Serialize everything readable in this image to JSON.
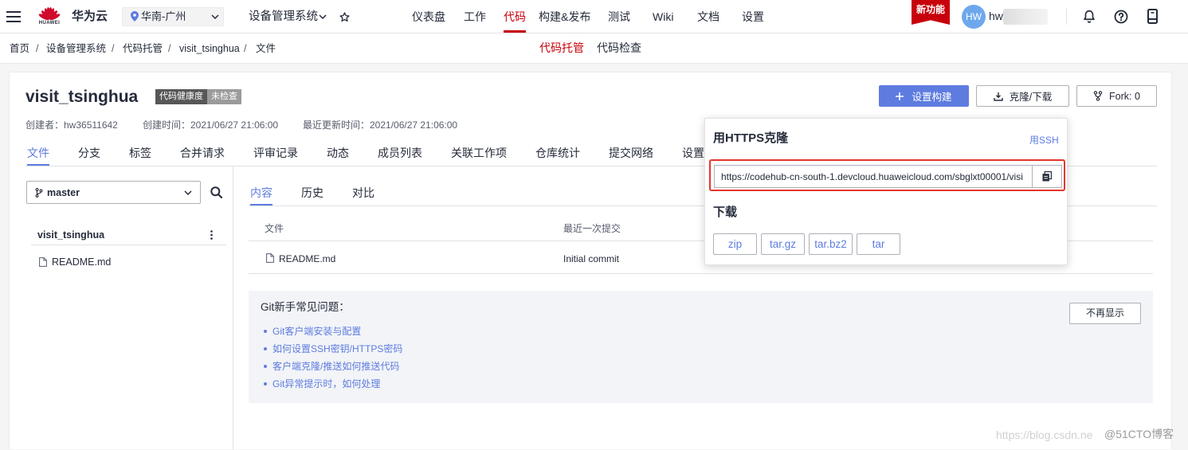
{
  "topnav": {
    "logo_text": "HUAWEI",
    "brand": "华为云",
    "region": "华南-广州",
    "project": "设备管理系统",
    "menu": [
      "仪表盘",
      "工作",
      "代码",
      "构建&发布",
      "测试",
      "Wiki",
      "文档",
      "设置"
    ],
    "active_index": 2,
    "new_feature_badge": "新功能",
    "avatar_initials": "HW",
    "username_visible": "hw"
  },
  "breadcrumb": {
    "items": [
      "首页",
      "设备管理系统",
      "代码托管",
      "visit_tsinghua",
      "文件"
    ],
    "separator": "/"
  },
  "service_tabs": {
    "items": [
      "代码托管",
      "代码检查"
    ],
    "active_index": 0
  },
  "repo": {
    "name": "visit_tsinghua",
    "health_label": "代码健康度",
    "health_status": "未检查",
    "creator": "创建者：hw36511642",
    "created_time": "创建时间：2021/06/27 21:06:00",
    "updated_time": "最近更新时间：2021/06/27 21:06:00"
  },
  "actions": {
    "setup_build": "设置构建",
    "clone_download": "克隆/下载",
    "fork": "Fork: 0"
  },
  "repo_tabs": {
    "items": [
      "文件",
      "分支",
      "标签",
      "合并请求",
      "评审记录",
      "动态",
      "成员列表",
      "关联工作项",
      "仓库统计",
      "提交网络",
      "设置"
    ],
    "active_index": 0
  },
  "file_tree": {
    "branch": "master",
    "root": "visit_tsinghua",
    "files": [
      "README.md"
    ]
  },
  "content_tabs": {
    "items": [
      "内容",
      "历史",
      "对比"
    ],
    "active_index": 0
  },
  "file_table": {
    "columns": [
      "文件",
      "最近一次提交"
    ],
    "rows": [
      {
        "name": "README.md",
        "last_commit": "Initial commit"
      }
    ]
  },
  "git_help": {
    "title": "Git新手常见问题：",
    "links": [
      "Git客户端安装与配置",
      "如何设置SSH密钥/HTTPS密码",
      "客户端克隆/推送如何推送代码",
      "Git异常提示时，如何处理"
    ],
    "dismiss": "不再显示"
  },
  "clone_popover": {
    "title": "用HTTPS克隆",
    "switch_link": "用SSH",
    "url": "https://codehub-cn-south-1.devcloud.huaweicloud.com/sbglxt00001/visi",
    "download_title": "下载",
    "formats": [
      "zip",
      "tar.gz",
      "tar.bz2",
      "tar"
    ]
  },
  "watermark": {
    "url_text": "https://blog.csdn.ne",
    "source": "@51CTO博客"
  },
  "colors": {
    "brand_red": "#c7000b",
    "accent_blue": "#5e7ce0",
    "highlight_red": "#e5352b",
    "avatar_blue": "#6ea8ec",
    "help_bg": "#f2f4f7"
  },
  "icons": [
    "menu-icon",
    "huawei-logo",
    "location-pin-icon",
    "chevron-down-icon",
    "star-icon",
    "bell-icon",
    "help-icon",
    "device-icon",
    "plus-icon",
    "download-icon",
    "fork-icon",
    "branch-icon",
    "search-icon",
    "more-vertical-icon",
    "file-icon",
    "copy-icon"
  ]
}
